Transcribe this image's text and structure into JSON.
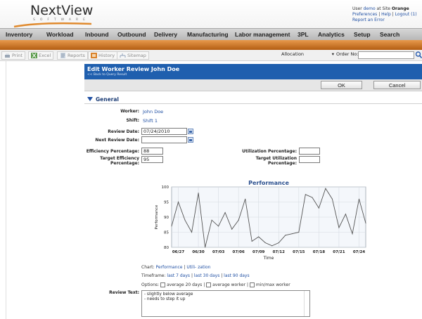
{
  "brand": {
    "name": "NextView",
    "subtitle": "SOFTWARE"
  },
  "user": {
    "prefix": "User",
    "name": "demo",
    "at": "at Site",
    "site": "Orange",
    "links": [
      "Preferences",
      "Help",
      "Logout (1)"
    ],
    "report": "Report an Error"
  },
  "nav": [
    "Inventory",
    "Workload",
    "Inbound",
    "Outbound",
    "Delivery",
    "Manufacturing",
    "Labor management",
    "3PL",
    "Analytics",
    "Setup",
    "Search"
  ],
  "toolbar": {
    "buttons": [
      "Print",
      "Excel",
      "Reports",
      "History",
      "Sitemap"
    ],
    "select_value": "Allocation",
    "order_label": "Order No:",
    "order_value": ""
  },
  "panel": {
    "title": "Edit Worker Review John Doe",
    "back": "<< Back to Query Result",
    "ok": "OK",
    "cancel": "Cancel"
  },
  "section": {
    "title": "General"
  },
  "form": {
    "worker_label": "Worker:",
    "worker": "John Doe",
    "shift_label": "Shift:",
    "shift": "Shift 1",
    "review_date_label": "Review Date:",
    "review_date": "07/24/2010",
    "next_review_label": "Next Review Date:",
    "next_review": "",
    "eff_label": "Efficiency Percentage:",
    "eff": "88",
    "target_eff_label_1": "Target Efficiency",
    "target_eff_label_2": "Percentage:",
    "target_eff": "95",
    "util_label": "Utilization Percentage:",
    "util": "",
    "target_util_label_1": "Target Utilization",
    "target_util_label_2": "Percentage:",
    "target_util": ""
  },
  "chart_data": {
    "type": "line",
    "title": "Performance",
    "xlabel": "Time",
    "ylabel": "Performance",
    "ylim": [
      80,
      100
    ],
    "yticks": [
      "100",
      "95",
      "90",
      "85",
      "80"
    ],
    "xticks": [
      "06/27",
      "06/30",
      "07/03",
      "07/06",
      "07/09",
      "07/12",
      "07/15",
      "07/18",
      "07/21",
      "07/24"
    ],
    "grid": true,
    "x": [
      "06/26",
      "06/27",
      "06/28",
      "06/29",
      "06/30",
      "07/01",
      "07/02",
      "07/03",
      "07/04",
      "07/05",
      "07/06",
      "07/07",
      "07/08",
      "07/09",
      "07/10",
      "07/11",
      "07/12",
      "07/13",
      "07/14",
      "07/15",
      "07/16",
      "07/17",
      "07/18",
      "07/19",
      "07/20",
      "07/21",
      "07/22",
      "07/23",
      "07/24",
      "07/25"
    ],
    "values": [
      87,
      95,
      89,
      85,
      98,
      80,
      89,
      87,
      91.5,
      86,
      89,
      96,
      82,
      83.5,
      81.5,
      80.5,
      81.5,
      84,
      84.5,
      85,
      97.5,
      96.5,
      93,
      99.5,
      96,
      86.5,
      91,
      84.5,
      96,
      88
    ]
  },
  "chart_controls": {
    "chart_label": "Chart:",
    "chart_opt1": "Performance",
    "chart_opt2": "Utili- zation",
    "timeframe_label": "Timeframe:",
    "tf1": "last 7 days",
    "tf2": "last 30 days",
    "tf3": "last 90 days",
    "options_label": "Options:",
    "opt1": "average 20 days",
    "opt2": "average worker",
    "opt3": "min/max worker"
  },
  "review": {
    "label": "Review Text:",
    "line1": "- slightly below average",
    "line2": "- needs to step it up"
  },
  "colors": {
    "accent": "#1f5fae",
    "nav_orange": "#d07a2a",
    "series": "#555555"
  }
}
